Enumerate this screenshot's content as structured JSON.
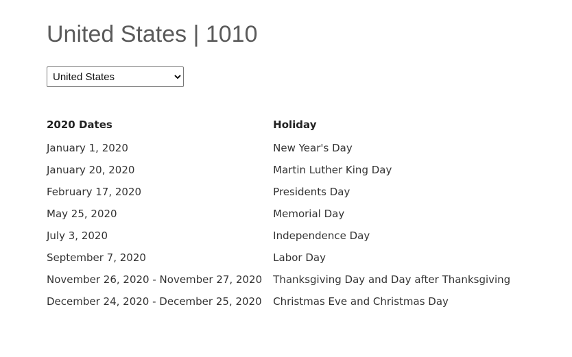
{
  "page": {
    "title": "United States | 1010"
  },
  "country_select": {
    "selected": "United States"
  },
  "table": {
    "headers": {
      "dates": "2020 Dates",
      "holiday": "Holiday"
    },
    "rows": [
      {
        "date": "January 1, 2020",
        "holiday": "New Year's Day"
      },
      {
        "date": "January 20, 2020",
        "holiday": "Martin Luther King Day"
      },
      {
        "date": "February 17, 2020",
        "holiday": "Presidents Day"
      },
      {
        "date": "May 25, 2020",
        "holiday": "Memorial Day"
      },
      {
        "date": "July 3, 2020",
        "holiday": "Independence Day"
      },
      {
        "date": "September 7, 2020",
        "holiday": "Labor Day"
      },
      {
        "date": "November 26, 2020 - November 27, 2020",
        "holiday": "Thanksgiving Day and Day after Thanksgiving"
      },
      {
        "date": "December 24, 2020 - December 25, 2020",
        "holiday": "Christmas Eve and Christmas Day"
      }
    ]
  }
}
